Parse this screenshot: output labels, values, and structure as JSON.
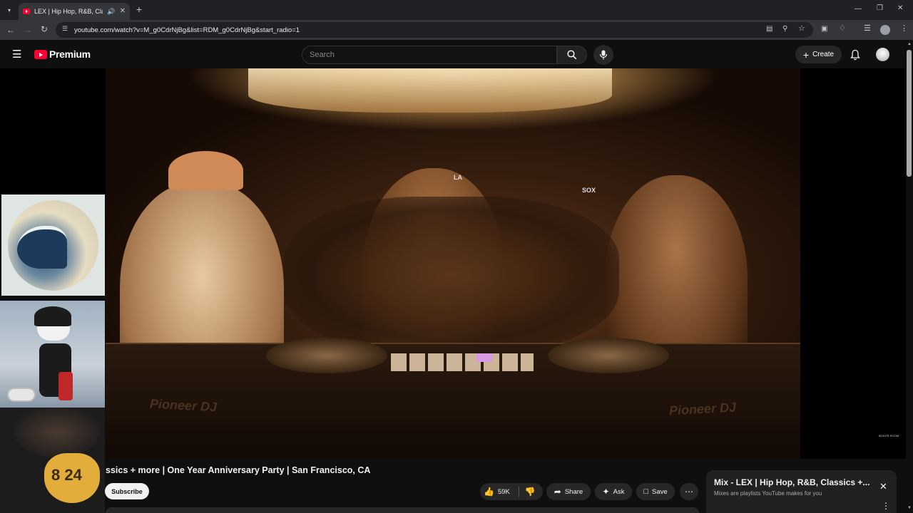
{
  "browser": {
    "tab_title": "LEX | Hip Hop, R&B, Classic",
    "new_tab_symbol": "+",
    "url": "youtube.com/watch?v=M_g0CdrNjBg&list=RDM_g0CdrNjBg&start_radio=1"
  },
  "youtube": {
    "brand": "Premium",
    "search_placeholder": "Search",
    "create_label": "Create"
  },
  "video": {
    "title_visible": "ssics + more | One Year Anniversary Party | San Francisco, CA",
    "deck_brand_left": "Pioneer DJ",
    "deck_brand_right": "Pioneer DJ",
    "cap_logo": "LA",
    "cap_logo_right": "SOX",
    "watermark": "BOILER ROOM"
  },
  "overlays": {
    "jersey_number": "8 24"
  },
  "actions": {
    "subscribe_label": "Subscribe",
    "like_count": "59K",
    "share_label": "Share",
    "ask_label": "Ask",
    "save_label": "Save"
  },
  "mix": {
    "title": "Mix - LEX | Hip Hop, R&B, Classics +...",
    "subtitle": "Mixes are playlists YouTube makes for you"
  },
  "colors": {
    "youtube_red": "#ff0033",
    "background": "#0f0f0f",
    "chip": "#272727"
  }
}
